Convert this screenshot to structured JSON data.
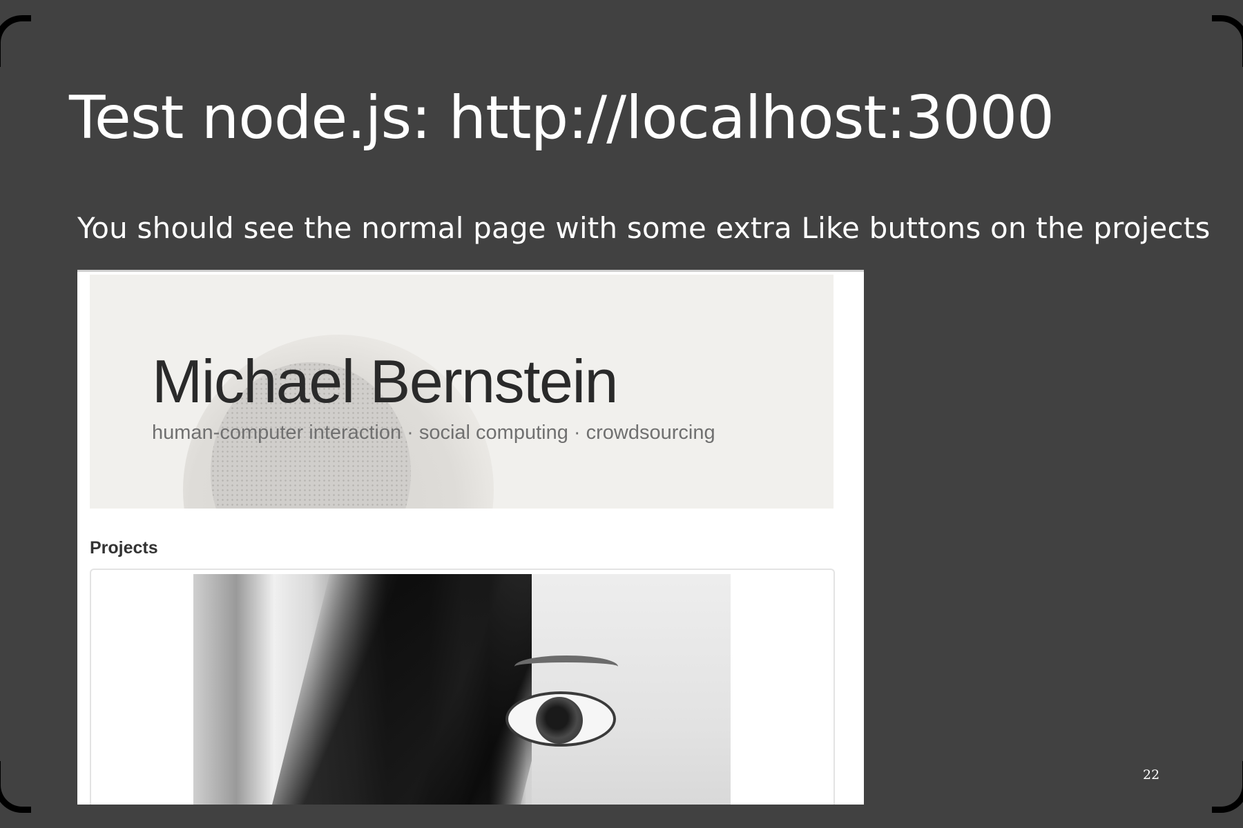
{
  "slide": {
    "title": "Test node.js: http://localhost:3000",
    "subtitle": "You should see the normal page with some extra Like buttons on the projects",
    "page_number": "22"
  },
  "webpage": {
    "hero": {
      "name": "Michael Bernstein",
      "tagline": "human-computer interaction · social computing · crowdsourcing"
    },
    "projects_heading": "Projects"
  },
  "colors": {
    "slide_background": "#414141",
    "text_on_slide": "#ffffff",
    "hero_background": "#f1f0ed",
    "hero_name": "#2a2a2a",
    "hero_tagline": "#707070"
  }
}
